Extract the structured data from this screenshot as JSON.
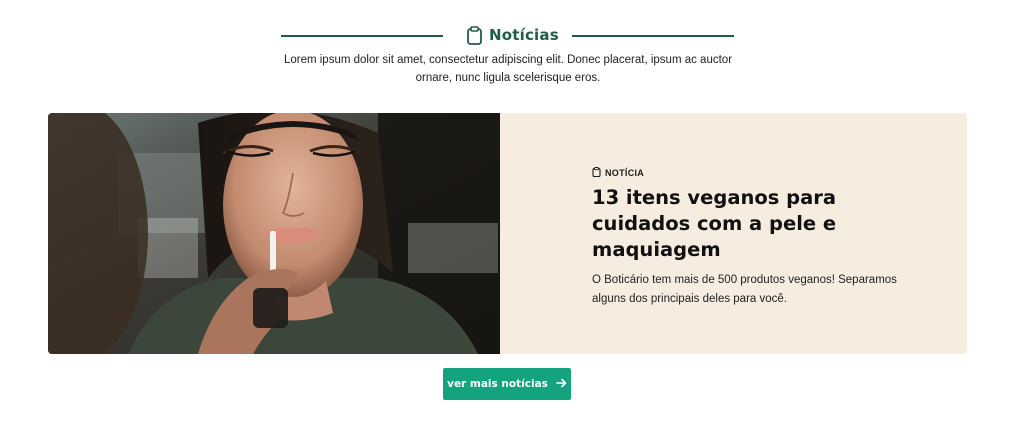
{
  "section": {
    "title": "Notícias",
    "icon": "notepad-icon",
    "intro": "Lorem ipsum dolor sit amet, consectetur adipiscing elit. Donec placerat, ipsum ac auctor ornare, nunc ligula scelerisque eros."
  },
  "featured": {
    "tag": "NOTÍCIA",
    "headline": "13 itens veganos para cuidados com a pele e maquiagem",
    "summary": "O Boticário tem mais de 500 produtos veganos! Separamos alguns dos principais deles para você."
  },
  "cta": {
    "label": "ver mais notícias",
    "icon": "arrow-right-icon"
  },
  "colors": {
    "brand_green": "#1f5d45",
    "button_green": "#14a37f",
    "card_bg": "#f6ede0"
  }
}
